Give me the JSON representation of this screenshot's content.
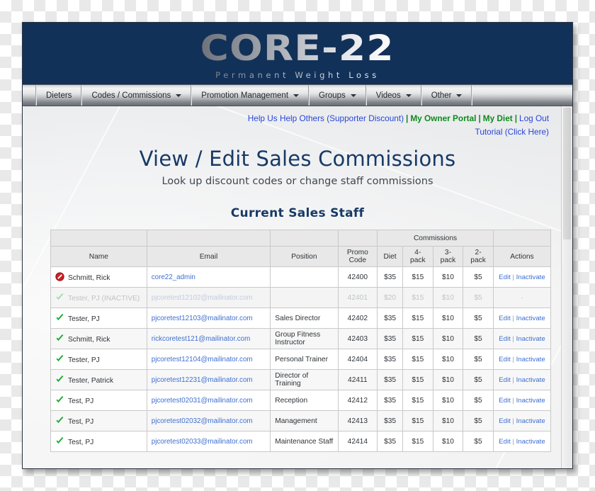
{
  "brand": {
    "logo_text": "CORE-22",
    "tagline": "Permanent Weight Loss",
    "navy": "#123158",
    "link_blue": "#2646d8",
    "green": "#0e8a1e"
  },
  "nav": {
    "items": [
      {
        "label": "Dieters",
        "has_caret": false
      },
      {
        "label": "Codes / Commissions",
        "has_caret": true
      },
      {
        "label": "Promotion Management",
        "has_caret": true
      },
      {
        "label": "Groups",
        "has_caret": true
      },
      {
        "label": "Videos",
        "has_caret": true
      },
      {
        "label": "Other",
        "has_caret": true
      }
    ]
  },
  "toplinks": {
    "supporter": "Help Us Help Others (Supporter Discount)",
    "sep1": "|",
    "owner_portal": "My Owner Portal",
    "sep2": "|",
    "my_diet": "My Diet",
    "sep3": "|",
    "logout": "Log Out",
    "tutorial": "Tutorial (Click Here)"
  },
  "page": {
    "title": "View / Edit Sales Commissions",
    "subtitle": "Look up discount codes or change staff commissions",
    "section_title": "Current Sales Staff"
  },
  "table": {
    "group_header": "Commissions",
    "columns": [
      "Name",
      "Email",
      "Position",
      "Promo Code",
      "Diet",
      "4-pack",
      "3-pack",
      "2-pack",
      "Actions"
    ],
    "action_edit": "Edit",
    "action_divider": "|",
    "action_inactivate": "Inactivate",
    "inactive_action_placeholder": "-",
    "rows": [
      {
        "status_icon": "prohibited-icon",
        "name": "Schmitt, Rick",
        "email": "core22_admin",
        "position": "",
        "promo_code": "42400",
        "diet": "$35",
        "pack4": "$15",
        "pack3": "$10",
        "pack2": "$5",
        "inactive": false
      },
      {
        "status_icon": "check-icon",
        "name": "Tester, PJ (INACTIVE)",
        "email": "pjcoretest12102@mailinator.com",
        "position": "",
        "promo_code": "42401",
        "diet": "$20",
        "pack4": "$15",
        "pack3": "$10",
        "pack2": "$5",
        "inactive": true
      },
      {
        "status_icon": "check-icon",
        "name": "Tester, PJ",
        "email": "pjcoretest12103@mailinator.com",
        "position": "Sales Director",
        "promo_code": "42402",
        "diet": "$35",
        "pack4": "$15",
        "pack3": "$10",
        "pack2": "$5",
        "inactive": false
      },
      {
        "status_icon": "check-icon",
        "name": "Schmitt, Rick",
        "email": "rickcoretest121@mailinator.com",
        "position": "Group Fitness Instructor",
        "promo_code": "42403",
        "diet": "$35",
        "pack4": "$15",
        "pack3": "$10",
        "pack2": "$5",
        "inactive": false
      },
      {
        "status_icon": "check-icon",
        "name": "Tester, PJ",
        "email": "pjcoretest12104@mailinator.com",
        "position": "Personal Trainer",
        "promo_code": "42404",
        "diet": "$35",
        "pack4": "$15",
        "pack3": "$10",
        "pack2": "$5",
        "inactive": false
      },
      {
        "status_icon": "check-icon",
        "name": "Tester, Patrick",
        "email": "pjcoretest12231@mailinator.com",
        "position": "Director of Training",
        "promo_code": "42411",
        "diet": "$35",
        "pack4": "$15",
        "pack3": "$10",
        "pack2": "$5",
        "inactive": false
      },
      {
        "status_icon": "check-icon",
        "name": "Test, PJ",
        "email": "pjcoretest02031@mailinator.com",
        "position": "Reception",
        "promo_code": "42412",
        "diet": "$35",
        "pack4": "$15",
        "pack3": "$10",
        "pack2": "$5",
        "inactive": false
      },
      {
        "status_icon": "check-icon",
        "name": "Test, PJ",
        "email": "pjcoretest02032@mailinator.com",
        "position": "Management",
        "promo_code": "42413",
        "diet": "$35",
        "pack4": "$15",
        "pack3": "$10",
        "pack2": "$5",
        "inactive": false
      },
      {
        "status_icon": "check-icon",
        "name": "Test, PJ",
        "email": "pjcoretest02033@mailinator.com",
        "position": "Maintenance Staff",
        "promo_code": "42414",
        "diet": "$35",
        "pack4": "$15",
        "pack3": "$10",
        "pack2": "$5",
        "inactive": false
      }
    ]
  }
}
